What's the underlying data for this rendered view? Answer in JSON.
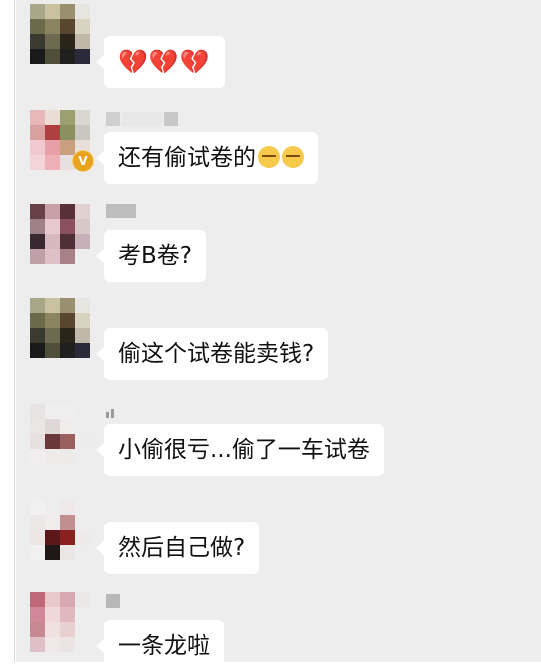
{
  "messages": [
    {
      "id": "m1",
      "text": "💔💔💔"
    },
    {
      "id": "m2",
      "text": "还有偷试卷的",
      "emojis": [
        "cry-laugh-emoji",
        "cry-laugh-emoji"
      ],
      "badge": "V"
    },
    {
      "id": "m3",
      "text": "考B卷?"
    },
    {
      "id": "m4",
      "text": "偷这个试卷能卖钱?"
    },
    {
      "id": "m5",
      "text": "小偷很亏...偷了一车试卷"
    },
    {
      "id": "m6",
      "text": "然后自己做?"
    },
    {
      "id": "m7",
      "text": "一条龙啦"
    }
  ],
  "colors": {
    "background": "#ededed",
    "bubble": "#ffffff",
    "heart": "#f08a1c",
    "badge": "#e8a21e"
  }
}
